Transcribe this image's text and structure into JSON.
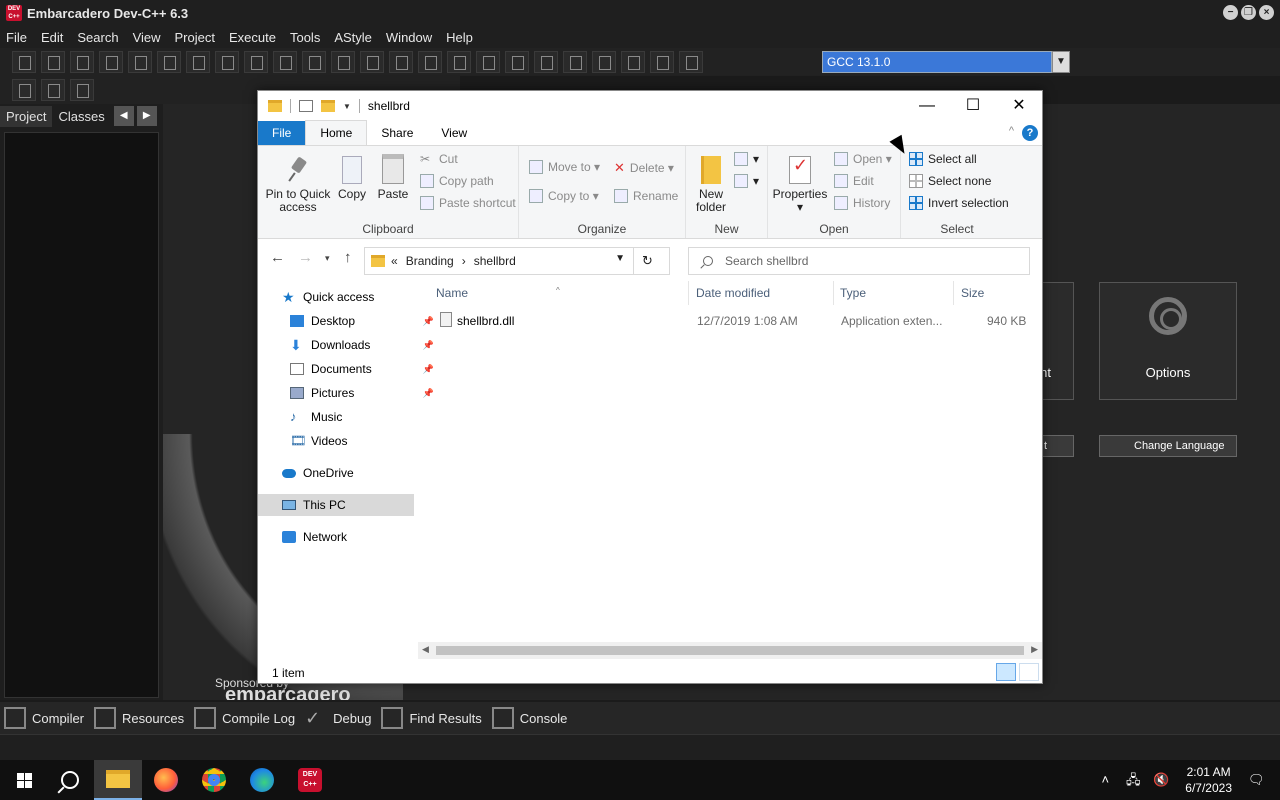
{
  "ide": {
    "title": "Embarcadero Dev-C++ 6.3",
    "menu": [
      "File",
      "Edit",
      "Search",
      "View",
      "Project",
      "Execute",
      "Tools",
      "AStyle",
      "Window",
      "Help"
    ],
    "compiler": "GCC 13.1.0",
    "left_tabs": {
      "project": "Project",
      "classes": "Classes"
    },
    "cards": {
      "partial_label": "nt",
      "options_label": "Options"
    },
    "buttons": {
      "partial_label": "t",
      "change_language": "Change Language"
    },
    "sponsored_by": "Sponsored by",
    "sponsor_name": "embarcadero",
    "bottom_tabs": [
      "Compiler",
      "Resources",
      "Compile Log",
      "Debug",
      "Find Results",
      "Console"
    ]
  },
  "taskbar": {
    "time": "2:01 AM",
    "date": "6/7/2023"
  },
  "explorer": {
    "title": "shellbrd",
    "ribbon_tabs": {
      "file": "File",
      "home": "Home",
      "share": "Share",
      "view": "View"
    },
    "ribbon": {
      "clipboard": {
        "label": "Clipboard",
        "pin": "Pin to Quick access",
        "copy": "Copy",
        "paste": "Paste",
        "cut": "Cut",
        "copy_path": "Copy path",
        "paste_shortcut": "Paste shortcut"
      },
      "organize": {
        "label": "Organize",
        "move_to": "Move to",
        "copy_to": "Copy to",
        "delete": "Delete",
        "rename": "Rename"
      },
      "new": {
        "label": "New",
        "new_folder": "New folder"
      },
      "open": {
        "label": "Open",
        "properties": "Properties",
        "open": "Open",
        "edit": "Edit",
        "history": "History"
      },
      "select": {
        "label": "Select",
        "select_all": "Select all",
        "select_none": "Select none",
        "invert_selection": "Invert selection"
      }
    },
    "address": {
      "prefix": "«",
      "segments": [
        "Branding",
        "shellbrd"
      ]
    },
    "search_placeholder": "Search shellbrd",
    "nav_pane": {
      "quick_access": "Quick access",
      "desktop": "Desktop",
      "downloads": "Downloads",
      "documents": "Documents",
      "pictures": "Pictures",
      "music": "Music",
      "videos": "Videos",
      "onedrive": "OneDrive",
      "this_pc": "This PC",
      "network": "Network"
    },
    "columns": {
      "name": "Name",
      "date_modified": "Date modified",
      "type": "Type",
      "size": "Size"
    },
    "files": [
      {
        "name": "shellbrd.dll",
        "date_modified": "12/7/2019 1:08 AM",
        "type": "Application exten...",
        "size": "940 KB"
      }
    ],
    "status": "1 item"
  }
}
